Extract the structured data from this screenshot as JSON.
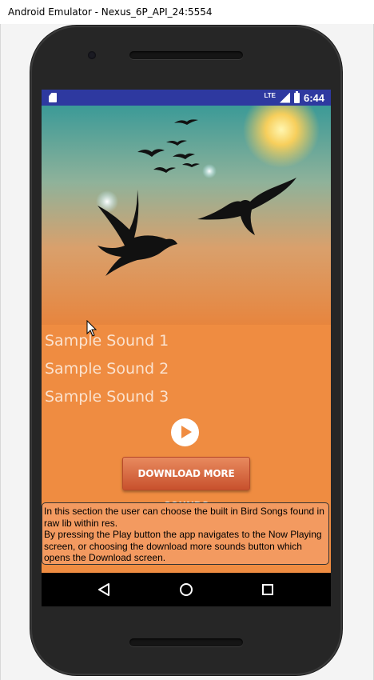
{
  "window": {
    "title": "Android Emulator - Nexus_6P_API_24:5554"
  },
  "status_bar": {
    "time": "6:44",
    "network": "LTE"
  },
  "sounds": [
    {
      "label": "Sample Sound 1"
    },
    {
      "label": "Sample Sound 2"
    },
    {
      "label": "Sample Sound 3"
    }
  ],
  "buttons": {
    "download_label": "DOWNLOAD MORE SOUNDS"
  },
  "info": {
    "text": "In this section the user can choose the built in Bird Songs found in raw lib within res.\n By pressing the Play button the app navigates to the Now Playing screen, or choosing the download more sounds button which opens the Download screen."
  },
  "colors": {
    "status_bar": "#2e39a0",
    "screen_bg": "#ef8c41",
    "button": "#d45f37",
    "info_bg": "#f39a60",
    "nav_bar": "#000000"
  }
}
